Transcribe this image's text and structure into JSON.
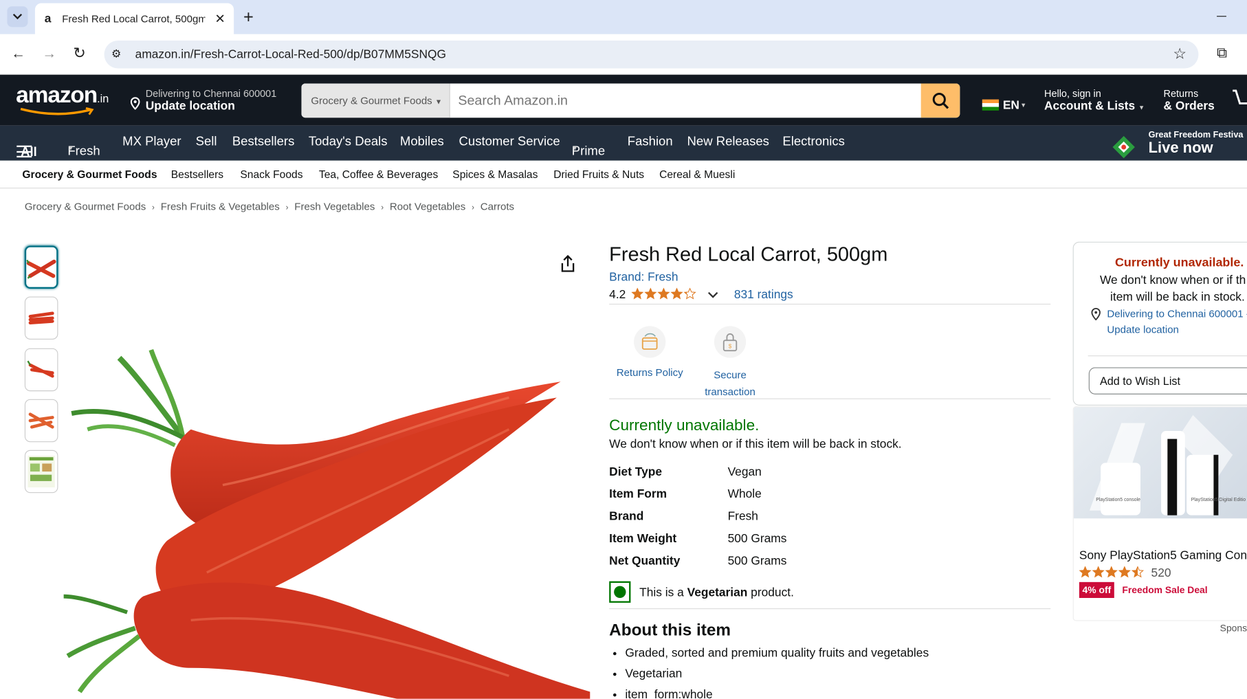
{
  "browser": {
    "tab_title": "Fresh Red Local Carrot, 500gm :",
    "url": "amazon.in/Fresh-Carrot-Local-Red-500/dp/B07MM5SNQG",
    "tab_favicon": "a"
  },
  "header": {
    "logo": "amazon",
    "logo_suffix": ".in",
    "deliver_line1": "Delivering to Chennai 600001",
    "deliver_line2": "Update location",
    "search_category": "Grocery & Gourmet Foods",
    "search_placeholder": "Search Amazon.in",
    "lang": "EN",
    "account_line1": "Hello, sign in",
    "account_line2": "Account & Lists",
    "returns_line1": "Returns",
    "returns_line2": "& Orders"
  },
  "nav": {
    "all": "All",
    "items": [
      "Fresh",
      "MX Player",
      "Sell",
      "Bestsellers",
      "Today's Deals",
      "Mobiles",
      "Customer Service",
      "Prime",
      "Fashion",
      "New Releases",
      "Electronics"
    ],
    "promo_line1": "Great Freedom Festiva",
    "promo_line2": "Live now"
  },
  "subnav": {
    "items": [
      "Grocery & Gourmet Foods",
      "Bestsellers",
      "Snack Foods",
      "Tea, Coffee & Beverages",
      "Spices & Masalas",
      "Dried Fruits & Nuts",
      "Cereal & Muesli"
    ]
  },
  "breadcrumb": [
    "Grocery & Gourmet Foods",
    "Fresh Fruits & Vegetables",
    "Fresh Vegetables",
    "Root Vegetables",
    "Carrots"
  ],
  "product": {
    "title": "Fresh Red Local Carrot, 500gm",
    "brand": "Brand: Fresh",
    "rating": "4.2",
    "stars": 4.2,
    "ratings_count": "831 ratings",
    "features": [
      "Returns Policy",
      "Secure transaction"
    ],
    "feature_secure_line1": "Secure",
    "feature_secure_line2": "transaction",
    "availability": "Currently unavailable.",
    "availability_note": "We don't know when or if this item will be back in stock.",
    "specs": [
      {
        "k": "Diet Type",
        "v": "Vegan"
      },
      {
        "k": "Item Form",
        "v": "Whole"
      },
      {
        "k": "Brand",
        "v": "Fresh"
      },
      {
        "k": "Item Weight",
        "v": "500 Grams"
      },
      {
        "k": "Net Quantity",
        "v": "500 Grams"
      }
    ],
    "veg_prefix": "This is a ",
    "veg_bold": "Vegetarian",
    "veg_suffix": " product.",
    "about_title": "About this item",
    "bullets": [
      "Graded, sorted and premium quality fruits and vegetables",
      "Vegetarian",
      "item_form:whole"
    ]
  },
  "buybox": {
    "unavailable": "Currently unavailable.",
    "note_line1": "We don't know when or if th",
    "note_line2": "item will be back in stock.",
    "deliver_line1": "Delivering to Chennai 600001 -",
    "deliver_line2": "Update location",
    "wishlist": "Add to Wish List"
  },
  "ad": {
    "title": "Sony PlayStation5 Gaming Con",
    "stars": 4.5,
    "count": "520",
    "badge": "4% off",
    "deal": "Freedom Sale Deal",
    "sponsored": "Spons",
    "console_label1": "PlayStation5 console",
    "console_label2": "PlayStation5 Digital Editio"
  },
  "colors": {
    "nav_dark": "#131921",
    "nav_mid": "#232f3e",
    "search_btn": "#febd69",
    "link": "#2162a1",
    "green": "#007600",
    "red": "#b12704",
    "star": "#de7921",
    "carrot": "#d63a20"
  }
}
